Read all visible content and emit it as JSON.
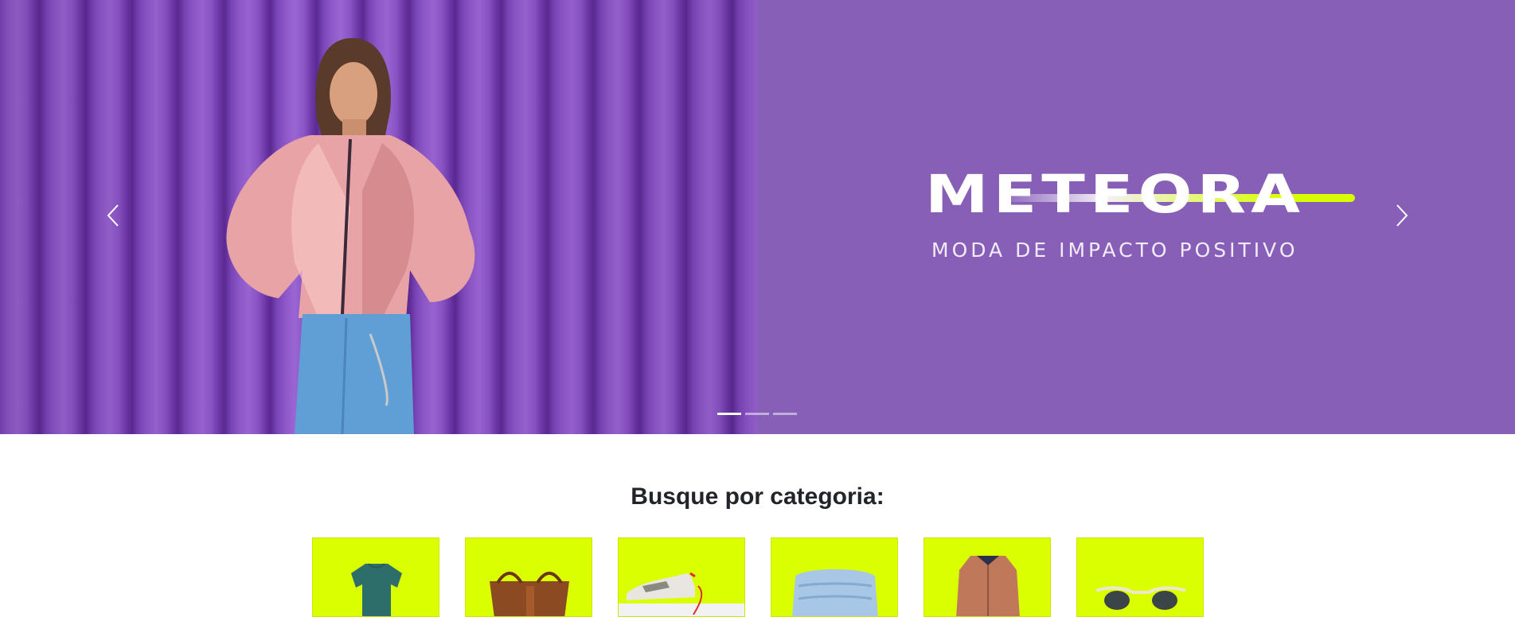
{
  "hero": {
    "brand": "METEORA",
    "tagline": "MODA DE IMPACTO POSITIVO",
    "prev_icon": "chevron-left-icon",
    "next_icon": "chevron-right-icon",
    "slides_total": 3,
    "active_slide": 1,
    "background_color": "#875fb7",
    "accent_color": "#d8ff00"
  },
  "categories": {
    "title": "Busque por categoria:",
    "card_color": "#d9ff00",
    "items": [
      {
        "icon": "tshirt-icon"
      },
      {
        "icon": "bag-icon"
      },
      {
        "icon": "sneaker-icon"
      },
      {
        "icon": "jeans-icon"
      },
      {
        "icon": "jacket-icon"
      },
      {
        "icon": "sunglasses-icon"
      }
    ]
  }
}
